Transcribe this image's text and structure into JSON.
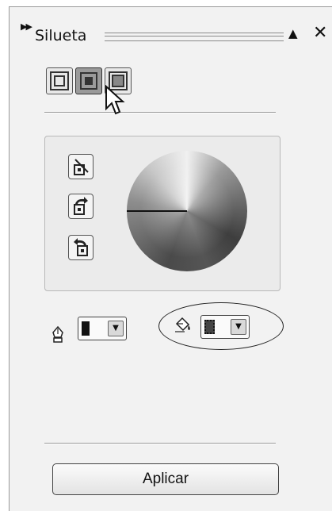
{
  "panel": {
    "title": "Silueta",
    "expander_icon": "double-chevron-right-icon",
    "collapse_icon": "triangle-up-icon",
    "close_icon": "close-icon"
  },
  "modes": [
    "contour-outside-icon",
    "contour-center-icon",
    "contour-inside-icon"
  ],
  "selected_mode_index": 1,
  "tools": [
    "linear-contour-icon",
    "clockwise-contour-icon",
    "counterclockwise-contour-icon"
  ],
  "outline_color": {
    "icon": "pen-nib-icon",
    "swatch": "#111111"
  },
  "fill_color": {
    "icon": "paint-bucket-icon",
    "swatch": "#444444"
  },
  "actions": {
    "apply_label": "Aplicar"
  }
}
